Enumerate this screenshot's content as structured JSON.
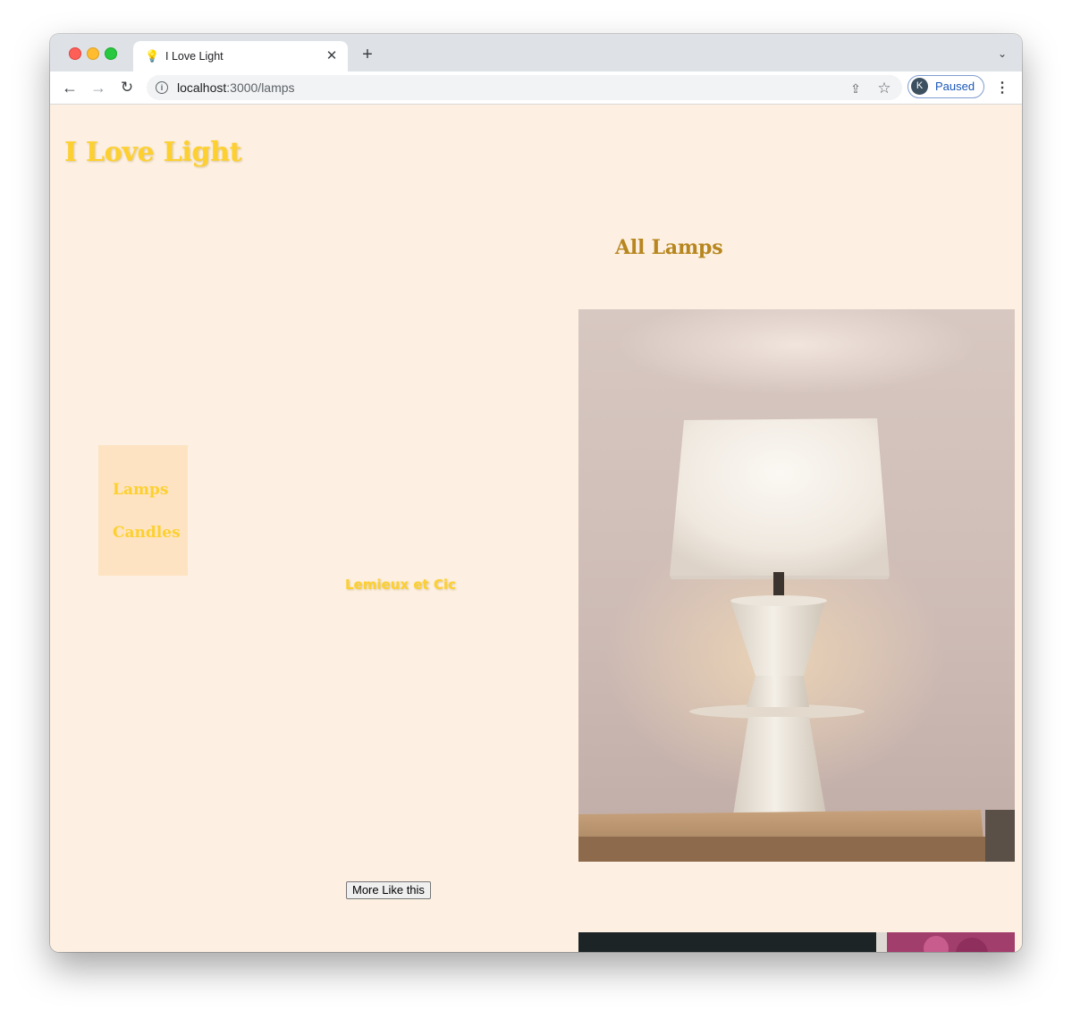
{
  "browser": {
    "tab_title": "I Love Light",
    "tab_favicon": "lightbulb-icon",
    "url_host": "localhost",
    "url_path": ":3000/lamps",
    "profile_initial": "K",
    "profile_status": "Paused"
  },
  "header": {
    "site_title": "I Love Light"
  },
  "main": {
    "section_title": "All Lamps"
  },
  "sidebar": {
    "items": [
      {
        "label": "Lamps"
      },
      {
        "label": "Candles"
      }
    ]
  },
  "product": {
    "name": "Lemieux et Cic",
    "more_button_label": "More Like this",
    "image": "table-lamp-photo"
  },
  "colors": {
    "page_background": "#fdf0e2",
    "sidebar_background": "#fde3c1",
    "site_title": "#fdd02f",
    "section_title": "#b7861e"
  }
}
